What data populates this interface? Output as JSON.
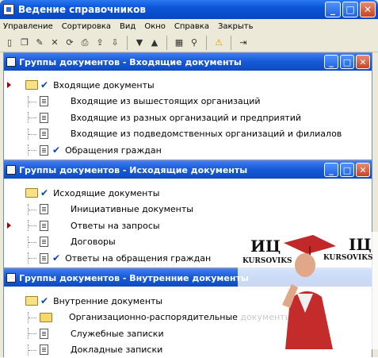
{
  "window": {
    "title": "Ведение справочников",
    "buttons": {
      "minimize": "_",
      "maximize": "□",
      "close": "✕"
    }
  },
  "menu": [
    "Управление",
    "Сортировка",
    "Вид",
    "Окно",
    "Справка",
    "Закрыть"
  ],
  "toolbar": {
    "icons": [
      "new-icon",
      "copy-icon",
      "edit-icon",
      "delete-icon",
      "refresh-icon",
      "print-icon",
      "export-icon",
      "import-icon",
      "move-down-icon",
      "move-up-icon",
      "grid-icon",
      "find-icon",
      "warning-icon",
      "exit-icon"
    ]
  },
  "panels": [
    {
      "title": "Группы документов - Входящие документы",
      "rows": [
        {
          "label": "Входящие документы",
          "kind": "folder",
          "checked": true,
          "marker": true
        },
        {
          "label": "Входящие из вышестоящих организаций",
          "kind": "doc"
        },
        {
          "label": "Входящие из разных организаций и предприятий",
          "kind": "doc"
        },
        {
          "label": "Входящие из подведомственных организаций и филиалов",
          "kind": "doc"
        },
        {
          "label": "Обращения граждан",
          "kind": "doc",
          "checked": true
        }
      ]
    },
    {
      "title": "Группы документов - Исходящие документы",
      "rows": [
        {
          "label": "Исходящие документы",
          "kind": "folder",
          "checked": true
        },
        {
          "label": "Инициативные документы",
          "kind": "doc"
        },
        {
          "label": "Ответы на запросы",
          "kind": "doc",
          "marker": true
        },
        {
          "label": "Договоры",
          "kind": "doc"
        },
        {
          "label": "Ответы на обращения граждан",
          "kind": "doc",
          "checked": true
        }
      ]
    },
    {
      "title": "Группы документов - Внутренние документы",
      "rows": [
        {
          "label": "Внутренние документы",
          "kind": "folder",
          "checked": true
        },
        {
          "label": "Организационно-распорядительные документы",
          "kind": "folder-closed"
        },
        {
          "label": "Служебные записки",
          "kind": "doc"
        },
        {
          "label": "Докладные записки",
          "kind": "doc"
        }
      ]
    }
  ],
  "watermark": {
    "left_logo": "ИЦ",
    "left_text": "KURSOVIKS",
    "right_logo": "IЦ",
    "right_text": "KURSOVIKS"
  }
}
